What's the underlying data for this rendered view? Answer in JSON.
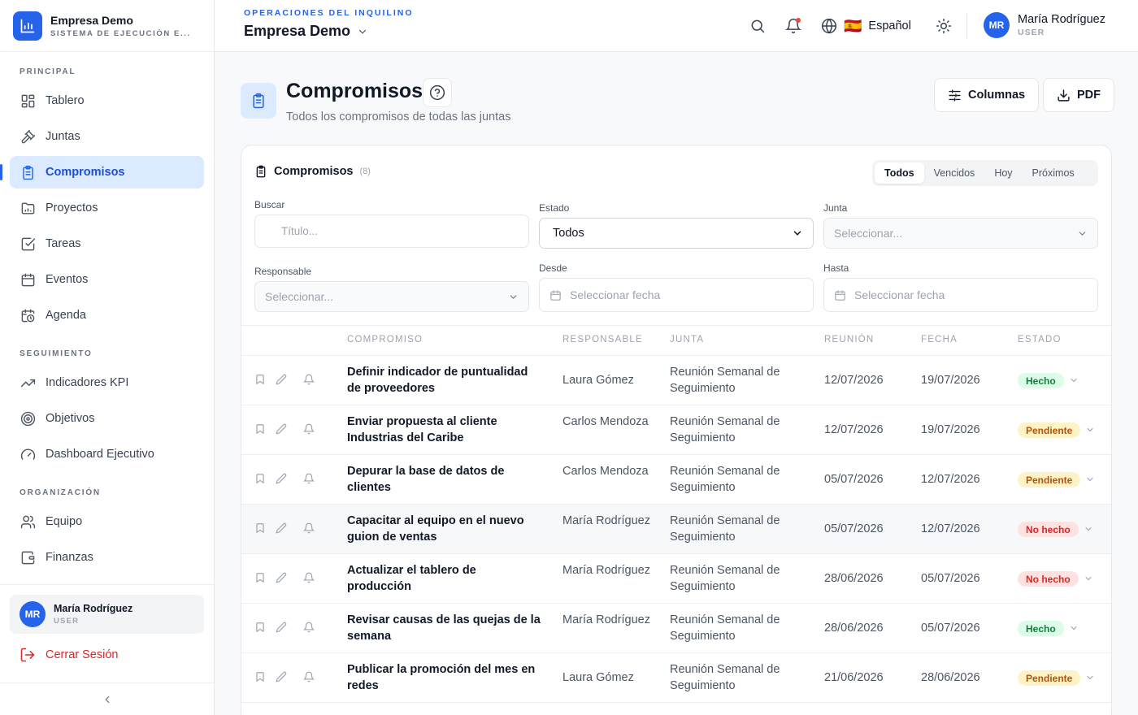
{
  "brand": {
    "name": "Empresa Demo",
    "subtitle": "SISTEMA DE EJECUCIÓN E..."
  },
  "sidebar": {
    "sections": [
      {
        "label": "PRINCIPAL"
      },
      {
        "label": "SEGUIMIENTO"
      },
      {
        "label": "ORGANIZACIÓN"
      }
    ],
    "items": [
      {
        "label": "Tablero",
        "icon": "grid-icon"
      },
      {
        "label": "Juntas",
        "icon": "gavel-icon"
      },
      {
        "label": "Compromisos",
        "icon": "clipboard-icon",
        "active": true
      },
      {
        "label": "Proyectos",
        "icon": "folder-icon"
      },
      {
        "label": "Tareas",
        "icon": "checkbox-icon"
      },
      {
        "label": "Eventos",
        "icon": "calendar-icon"
      },
      {
        "label": "Agenda",
        "icon": "calendar-clock-icon"
      },
      {
        "label": "Indicadores KPI",
        "icon": "trending-icon"
      },
      {
        "label": "Objetivos",
        "icon": "target-icon"
      },
      {
        "label": "Dashboard Ejecutivo",
        "icon": "gauge-icon"
      },
      {
        "label": "Equipo",
        "icon": "users-icon"
      },
      {
        "label": "Finanzas",
        "icon": "wallet-icon"
      }
    ],
    "user": {
      "initials": "MR",
      "name": "María Rodríguez",
      "role": "USER"
    },
    "logout_label": "Cerrar Sesión"
  },
  "header": {
    "tenant_label": "OPERACIONES DEL INQUILINO",
    "tenant_name": "Empresa Demo",
    "language": "Español",
    "flag": "🇪🇸",
    "user": {
      "initials": "MR",
      "name": "María Rodríguez",
      "role": "USER"
    }
  },
  "page": {
    "title": "Compromisos",
    "subtitle": "Todos los compromisos de todas las juntas",
    "columns_button": "Columnas",
    "pdf_button": "PDF"
  },
  "card": {
    "title": "Compromisos",
    "count": "(8)",
    "tabs": [
      "Todos",
      "Vencidos",
      "Hoy",
      "Próximos"
    ],
    "active_tab": "Todos"
  },
  "filters": {
    "search": {
      "label": "Buscar",
      "placeholder": "Título..."
    },
    "status": {
      "label": "Estado",
      "value": "Todos"
    },
    "junta": {
      "label": "Junta",
      "placeholder": "Seleccionar..."
    },
    "responsable": {
      "label": "Responsable",
      "placeholder": "Seleccionar..."
    },
    "desde": {
      "label": "Desde",
      "placeholder": "Seleccionar fecha"
    },
    "hasta": {
      "label": "Hasta",
      "placeholder": "Seleccionar fecha"
    }
  },
  "table": {
    "headers": [
      "COMPROMISO",
      "RESPONSABLE",
      "JUNTA",
      "REUNIÓN",
      "FECHA",
      "ESTADO"
    ],
    "rows": [
      {
        "title": "Definir indicador de puntualidad de proveedores",
        "responsable": "Laura Gómez",
        "junta": "Reunión Semanal de Seguimiento",
        "reunion": "12/07/2026",
        "fecha": "19/07/2026",
        "estado": "Hecho",
        "status_type": "done"
      },
      {
        "title": "Enviar propuesta al cliente Industrias del Caribe",
        "responsable": "Carlos Mendoza",
        "junta": "Reunión Semanal de Seguimiento",
        "reunion": "12/07/2026",
        "fecha": "19/07/2026",
        "estado": "Pendiente",
        "status_type": "pending"
      },
      {
        "title": "Depurar la base de datos de clientes",
        "responsable": "Carlos Mendoza",
        "junta": "Reunión Semanal de Seguimiento",
        "reunion": "05/07/2026",
        "fecha": "12/07/2026",
        "estado": "Pendiente",
        "status_type": "pending"
      },
      {
        "title": "Capacitar al equipo en el nuevo guion de ventas",
        "responsable": "María Rodríguez",
        "junta": "Reunión Semanal de Seguimiento",
        "reunion": "05/07/2026",
        "fecha": "12/07/2026",
        "estado": "No hecho",
        "status_type": "not_done"
      },
      {
        "title": "Actualizar el tablero de producción",
        "responsable": "María Rodríguez",
        "junta": "Reunión Semanal de Seguimiento",
        "reunion": "28/06/2026",
        "fecha": "05/07/2026",
        "estado": "No hecho",
        "status_type": "not_done"
      },
      {
        "title": "Revisar causas de las quejas de la semana",
        "responsable": "María Rodríguez",
        "junta": "Reunión Semanal de Seguimiento",
        "reunion": "28/06/2026",
        "fecha": "05/07/2026",
        "estado": "Hecho",
        "status_type": "done"
      },
      {
        "title": "Publicar la promoción del mes en redes",
        "responsable": "Laura Gómez",
        "junta": "Reunión Semanal de Seguimiento",
        "reunion": "21/06/2026",
        "fecha": "28/06/2026",
        "estado": "Pendiente",
        "status_type": "pending"
      }
    ]
  },
  "colors": {
    "accent": "#2563eb",
    "done": "#15803d",
    "pending": "#b45309",
    "not_done": "#dc2626"
  }
}
